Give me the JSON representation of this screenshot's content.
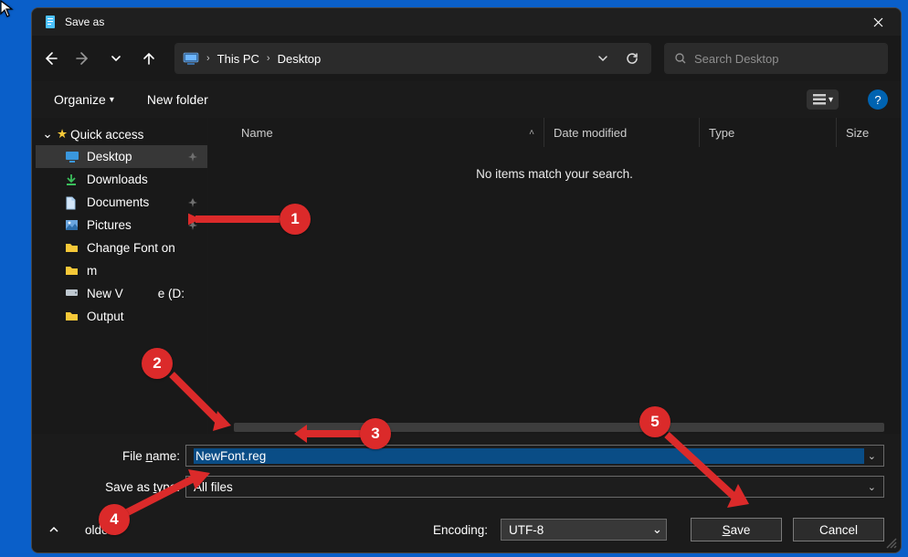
{
  "title": "Save as",
  "nav": {
    "breadcrumbs": [
      "This PC",
      "Desktop"
    ],
    "search_placeholder": "Search Desktop"
  },
  "toolbar": {
    "organize": "Organize",
    "new_folder": "New folder",
    "help": "?"
  },
  "sidebar": {
    "header": "Quick access",
    "items": [
      {
        "label": "Desktop",
        "icon": "desktop",
        "pinned": true,
        "selected": true
      },
      {
        "label": "Downloads",
        "icon": "download",
        "pinned": false,
        "selected": false
      },
      {
        "label": "Documents",
        "icon": "document",
        "pinned": true,
        "selected": false
      },
      {
        "label": "Pictures",
        "icon": "picture",
        "pinned": true,
        "selected": false
      },
      {
        "label": "Change Font on",
        "icon": "folder",
        "pinned": false,
        "selected": false
      },
      {
        "label": "m",
        "icon": "folder",
        "pinned": false,
        "selected": false
      },
      {
        "label": "New V",
        "suffix": "e (D:",
        "icon": "drive",
        "pinned": false,
        "selected": false
      },
      {
        "label": "Output",
        "icon": "folder",
        "pinned": false,
        "selected": false
      }
    ]
  },
  "columns": {
    "name": "Name",
    "date": "Date modified",
    "type": "Type",
    "size": "Size"
  },
  "file_list": {
    "empty_message": "No items match your search."
  },
  "form": {
    "filename_label_pre": "File ",
    "filename_label_accel": "n",
    "filename_label_post": "ame:",
    "filename_value": "NewFont.reg",
    "savetype_label_pre": "Save as ",
    "savetype_label_accel": "t",
    "savetype_label_post": "ype:",
    "savetype_value": "All files",
    "encoding_label": "Encoding:",
    "encoding_value": "UTF-8",
    "hide_folders_text_post": "olders"
  },
  "buttons": {
    "save_accel": "S",
    "save_rest": "ave",
    "cancel": "Cancel"
  },
  "annotations": {
    "1": "1",
    "2": "2",
    "3": "3",
    "4": "4",
    "5": "5"
  }
}
